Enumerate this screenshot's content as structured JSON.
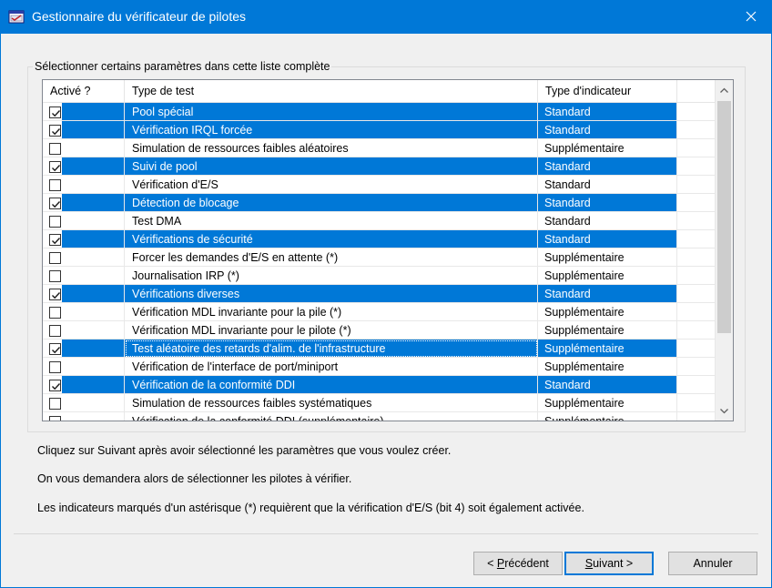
{
  "window": {
    "title": "Gestionnaire du vérificateur de pilotes",
    "accent": "#0078d7"
  },
  "group": {
    "label": "Sélectionner certains paramètres dans cette liste complète"
  },
  "table": {
    "columns": [
      "Activé ?",
      "Type de test",
      "Type d'indicateur",
      ""
    ],
    "rows": [
      {
        "checked": true,
        "selected": true,
        "name": "Pool spécial",
        "kind": "Standard"
      },
      {
        "checked": true,
        "selected": true,
        "name": "Vérification IRQL forcée",
        "kind": "Standard"
      },
      {
        "checked": false,
        "selected": false,
        "name": "Simulation de ressources faibles aléatoires",
        "kind": "Supplémentaire"
      },
      {
        "checked": true,
        "selected": true,
        "name": "Suivi de pool",
        "kind": "Standard"
      },
      {
        "checked": false,
        "selected": false,
        "name": "Vérification d'E/S",
        "kind": "Standard"
      },
      {
        "checked": true,
        "selected": true,
        "name": "Détection de blocage",
        "kind": "Standard"
      },
      {
        "checked": false,
        "selected": false,
        "name": "Test DMA",
        "kind": "Standard"
      },
      {
        "checked": true,
        "selected": true,
        "name": "Vérifications de sécurité",
        "kind": "Standard"
      },
      {
        "checked": false,
        "selected": false,
        "name": "Forcer les demandes d'E/S en attente (*)",
        "kind": "Supplémentaire"
      },
      {
        "checked": false,
        "selected": false,
        "name": "Journalisation IRP (*)",
        "kind": "Supplémentaire"
      },
      {
        "checked": true,
        "selected": true,
        "name": "Vérifications diverses",
        "kind": "Standard"
      },
      {
        "checked": false,
        "selected": false,
        "name": "Vérification MDL invariante pour la pile (*)",
        "kind": "Supplémentaire"
      },
      {
        "checked": false,
        "selected": false,
        "name": "Vérification MDL invariante pour le pilote (*)",
        "kind": "Supplémentaire"
      },
      {
        "checked": true,
        "selected": true,
        "focused": true,
        "name": "Test aléatoire des retards d'alim. de l'infrastructure",
        "kind": "Supplémentaire"
      },
      {
        "checked": false,
        "selected": false,
        "name": "Vérification de l'interface de port/miniport",
        "kind": "Supplémentaire"
      },
      {
        "checked": true,
        "selected": true,
        "name": "Vérification de la conformité DDI",
        "kind": "Standard"
      },
      {
        "checked": false,
        "selected": false,
        "name": "Simulation de ressources faibles systématiques",
        "kind": "Supplémentaire"
      },
      {
        "checked": false,
        "selected": false,
        "name": "Vérification de la conformité DDI (supplémentaire)",
        "kind": "Supplémentaire"
      }
    ]
  },
  "info": {
    "line1": "Cliquez sur Suivant après avoir sélectionné les paramètres que vous voulez créer.",
    "line2": "On vous demandera alors de sélectionner les pilotes à vérifier.",
    "line3": "Les indicateurs marqués d'un astérisque (*) requièrent que la vérification d'E/S (bit 4) soit également activée."
  },
  "buttons": {
    "back_lt": "< ",
    "back_key": "P",
    "back_rest": "récédent",
    "next_key": "S",
    "next_rest": "uivant >",
    "cancel": "Annuler"
  },
  "icons": {
    "app": "driver-verifier-icon",
    "close": "close-icon",
    "check": "checkmark-icon",
    "up": "chevron-up-icon",
    "down": "chevron-down-icon"
  }
}
